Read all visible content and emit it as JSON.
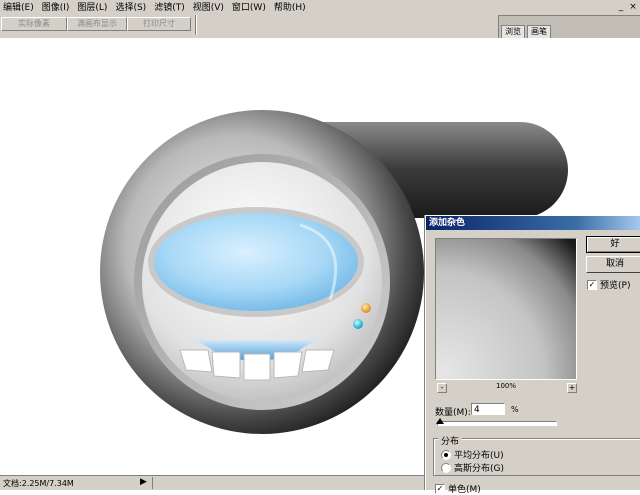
{
  "menubar": {
    "items": [
      "编辑(E)",
      "图像(I)",
      "图层(L)",
      "选择(S)",
      "滤镜(T)",
      "视图(V)",
      "窗口(W)",
      "帮助(H)"
    ],
    "window_controls": [
      "_",
      "×"
    ]
  },
  "optionsbar": {
    "actual_pixels": "实际像素",
    "fit_screen": "满画布显示",
    "print_size": "打印尺寸",
    "palette_tabs": [
      "浏览",
      "画笔"
    ]
  },
  "statusbar": {
    "doc_size": "文档:2.25M/7.34M",
    "arrow": "▶"
  },
  "dialog": {
    "title": "添加杂色",
    "ok": "好",
    "cancel": "取消",
    "preview_label": "预览(P)",
    "preview_checked": true,
    "zoom_minus": "-",
    "zoom_plus": "+",
    "zoom_level": "100%",
    "amount_label": "数量(M):",
    "amount_value": "4",
    "amount_unit": "%",
    "amount_fraction": 0.01,
    "distribution_title": "分布",
    "uniform_label": "平均分布(U)",
    "gaussian_label": "高斯分布(G)",
    "selected_distribution": "uniform",
    "monochrome_label": "单色(M)",
    "monochrome_checked": true
  },
  "colors": {
    "ui_face": "#d4d0c8",
    "title_bar": "#0a246a",
    "lens_blue": "#9fd4f4"
  }
}
